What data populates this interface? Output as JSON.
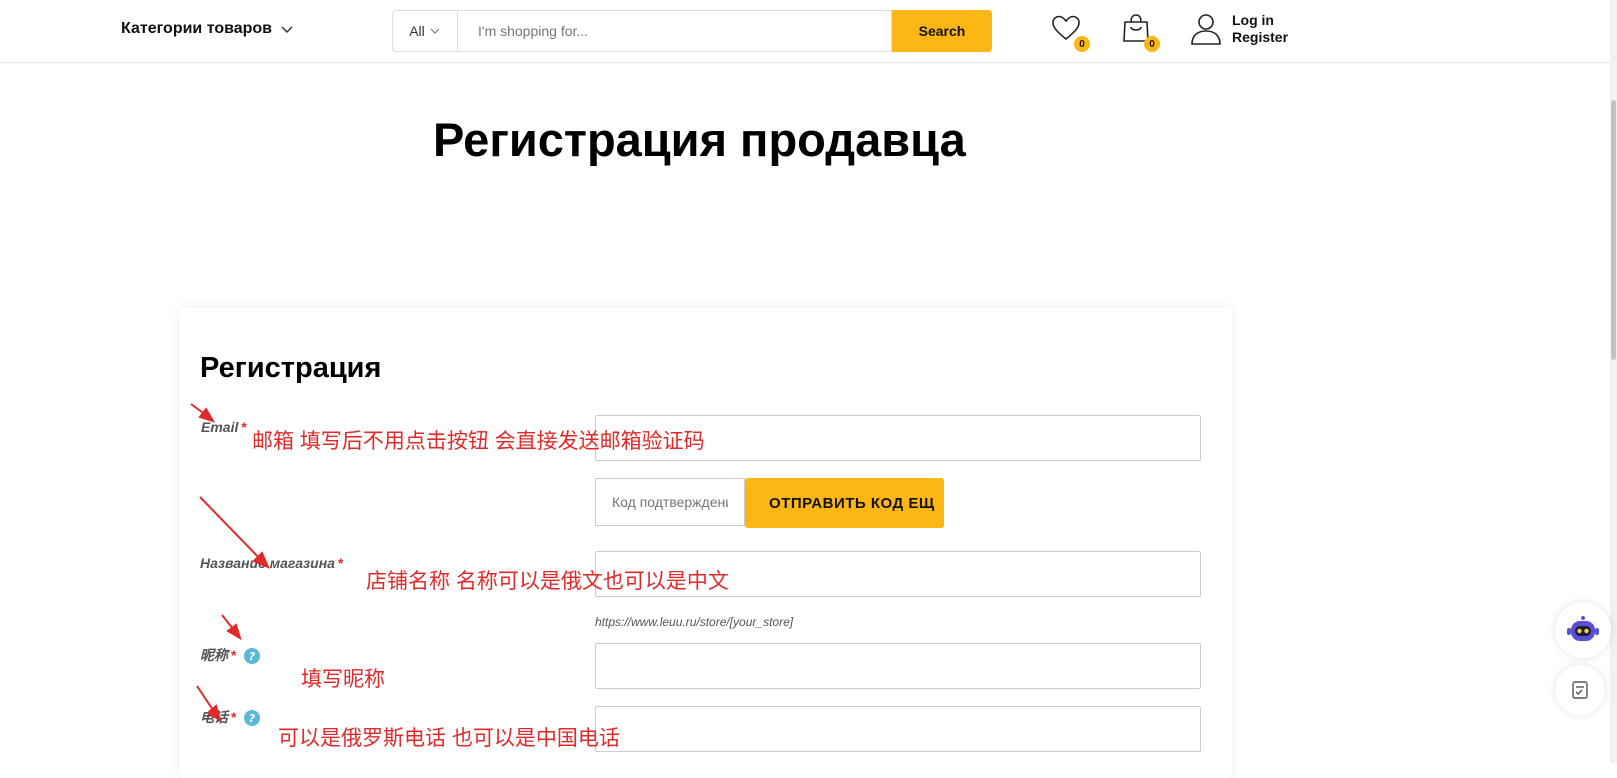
{
  "header": {
    "categories_label": "Категории товаров",
    "search_category": "All",
    "search_placeholder": "I'm shopping for...",
    "search_button": "Search",
    "wishlist_count": "0",
    "cart_count": "0",
    "login_label": "Log in",
    "register_label": "Register"
  },
  "page": {
    "title": "Регистрация продавца"
  },
  "form": {
    "title": "Регистрация",
    "email_label": "Email",
    "required_mark": "*",
    "code_placeholder": "Код подтверждения",
    "send_code_button": "ОТПРАВИТЬ КОД ЕЩ",
    "shop_name_label": "Название магазина",
    "store_url_hint": "https://www.leuu.ru/store/[your_store]",
    "nickname_label": "昵称",
    "phone_label": "电话"
  },
  "annotations": {
    "email_note": "邮箱 填写后不用点击按钮 会直接发送邮箱验证码",
    "shop_note": "店铺名称 名称可以是俄文也可以是中文",
    "nickname_note": "填写昵称",
    "phone_note": "可以是俄罗斯电话 也可以是中国电话",
    "color": "#e02a2a"
  },
  "colors": {
    "accent": "#fdb714"
  }
}
